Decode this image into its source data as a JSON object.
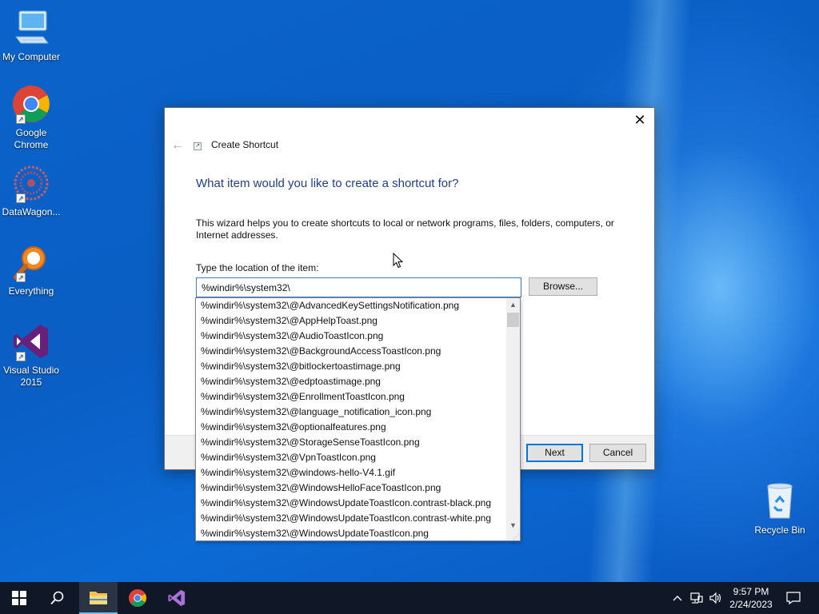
{
  "desktop": {
    "icons": [
      {
        "label": "My Computer"
      },
      {
        "label": "Google Chrome"
      },
      {
        "label": "DataWagon..."
      },
      {
        "label": "Everything"
      },
      {
        "label": "Visual Studio 2015"
      },
      {
        "label": "Recycle Bin"
      }
    ]
  },
  "dialog": {
    "title": "Create Shortcut",
    "heading": "What item would you like to create a shortcut for?",
    "description": "This wizard helps you to create shortcuts to local or network programs, files, folders, computers, or Internet addresses.",
    "location_label": "Type the location of the item:",
    "location_value": "%windir%\\system32\\",
    "browse_label": "Browse...",
    "next_label": "Next",
    "cancel_label": "Cancel",
    "close_glyph": "✕",
    "back_glyph": "←"
  },
  "autocomplete": {
    "items": [
      "%windir%\\system32\\@AdvancedKeySettingsNotification.png",
      "%windir%\\system32\\@AppHelpToast.png",
      "%windir%\\system32\\@AudioToastIcon.png",
      "%windir%\\system32\\@BackgroundAccessToastIcon.png",
      "%windir%\\system32\\@bitlockertoastimage.png",
      "%windir%\\system32\\@edptoastimage.png",
      "%windir%\\system32\\@EnrollmentToastIcon.png",
      "%windir%\\system32\\@language_notification_icon.png",
      "%windir%\\system32\\@optionalfeatures.png",
      "%windir%\\system32\\@StorageSenseToastIcon.png",
      "%windir%\\system32\\@VpnToastIcon.png",
      "%windir%\\system32\\@windows-hello-V4.1.gif",
      "%windir%\\system32\\@WindowsHelloFaceToastIcon.png",
      "%windir%\\system32\\@WindowsUpdateToastIcon.contrast-black.png",
      "%windir%\\system32\\@WindowsUpdateToastIcon.contrast-white.png",
      "%windir%\\system32\\@WindowsUpdateToastIcon.png"
    ]
  },
  "taskbar": {
    "time": "9:57 PM",
    "date": "2/24/2023"
  }
}
